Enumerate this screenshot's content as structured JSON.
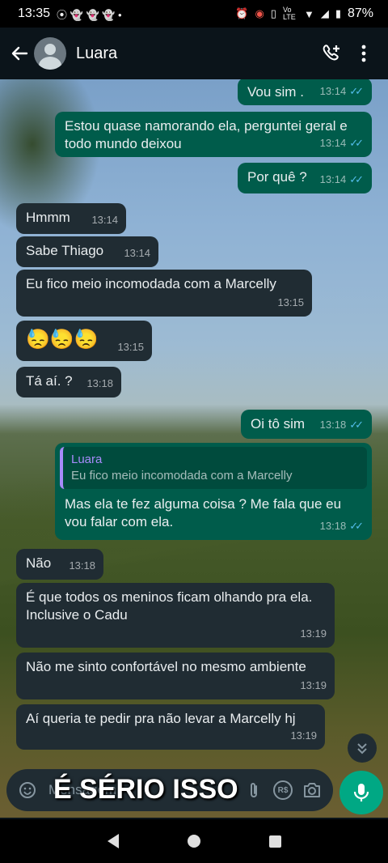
{
  "status_bar": {
    "time": "13:35",
    "left_icons": "⦿ 👻 👻 👻 •",
    "network": "Vo LTE",
    "battery": "87%"
  },
  "header": {
    "contact_name": "Luara",
    "back_icon": "arrow-left-icon",
    "call_icon": "add-call-icon",
    "menu_icon": "more-vertical-icon"
  },
  "messages": [
    {
      "dir": "out",
      "text": "Vou sim .",
      "time": "13:14",
      "read": true
    },
    {
      "dir": "out",
      "text": "Estou quase namorando ela, perguntei geral e todo mundo deixou",
      "time": "13:14",
      "read": true
    },
    {
      "dir": "out",
      "text": "Por quê ?",
      "time": "13:14",
      "read": true
    },
    {
      "dir": "in",
      "text": "Hmmm",
      "time": "13:14"
    },
    {
      "dir": "in",
      "text": "Sabe Thiago",
      "time": "13:14"
    },
    {
      "dir": "in",
      "text": "Eu fico meio incomodada com a Marcelly",
      "time": "13:15"
    },
    {
      "dir": "in",
      "text": "😓😓😓",
      "time": "13:15"
    },
    {
      "dir": "in",
      "text": "Tá aí. ?",
      "time": "13:18"
    },
    {
      "dir": "out",
      "text": "Oi tô sim",
      "time": "13:18",
      "read": true
    },
    {
      "dir": "out",
      "quote_name": "Luara",
      "quote_text": "Eu fico meio incomodada com a Marcelly",
      "text": "Mas ela te fez alguma coisa ? Me fala que eu vou falar com ela.",
      "time": "13:18",
      "read": true
    },
    {
      "dir": "in",
      "text": "Não",
      "time": "13:18"
    },
    {
      "dir": "in",
      "text": "É que todos os meninos ficam olhando pra ela.\nInclusive o Cadu",
      "time": "13:19"
    },
    {
      "dir": "in",
      "text": "Não me sinto confortável no mesmo ambiente",
      "time": "13:19"
    },
    {
      "dir": "in",
      "text": "Aí queria te pedir pra não levar a Marcelly hj",
      "time": "13:19"
    }
  ],
  "composer": {
    "placeholder": "Mensagem",
    "currency_label": "R$"
  },
  "overlay_caption": "É SÉRIO ISSO",
  "colors": {
    "incoming_bubble": "#202c33",
    "outgoing_bubble": "#005c4b",
    "read_ticks": "#53bdeb",
    "mic_button": "#00a884",
    "quote_accent": "#a78bfa"
  }
}
